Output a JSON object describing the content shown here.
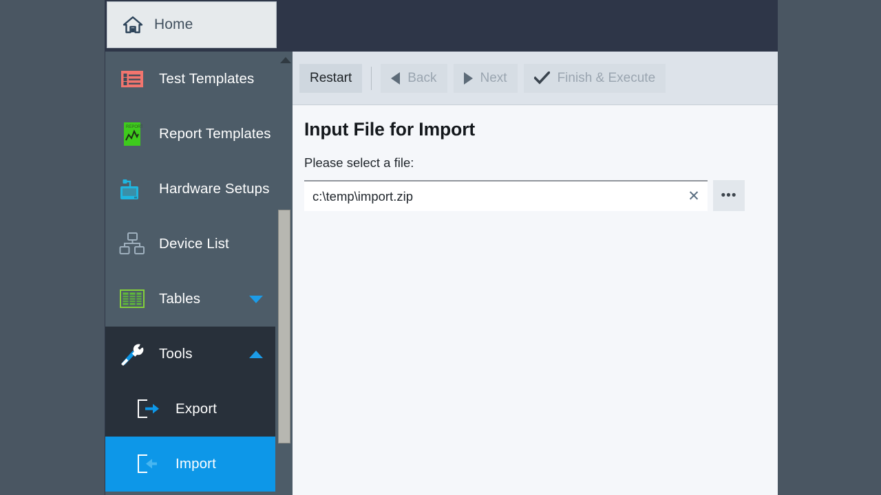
{
  "app": {
    "tab": {
      "label": "Home",
      "icon": "home-icon"
    }
  },
  "sidebar": {
    "items": [
      {
        "label": "Test Templates",
        "icon": "list-icon",
        "state": "normal",
        "chevron": ""
      },
      {
        "label": "Report Templates",
        "icon": "report-icon",
        "state": "normal",
        "chevron": ""
      },
      {
        "label": "Hardware Setups",
        "icon": "monitor-icon",
        "state": "normal",
        "chevron": ""
      },
      {
        "label": "Device List",
        "icon": "devices-icon",
        "state": "normal",
        "chevron": ""
      },
      {
        "label": "Tables",
        "icon": "table-icon",
        "state": "normal",
        "chevron": "chevron-down-icon"
      },
      {
        "label": "Tools",
        "icon": "tools-icon",
        "state": "expanded",
        "chevron": "chevron-up-icon"
      },
      {
        "label": "Export",
        "icon": "export-icon",
        "state": "sub",
        "chevron": ""
      },
      {
        "label": "Import",
        "icon": "import-icon",
        "state": "selected",
        "chevron": ""
      }
    ],
    "scroll": {
      "up_arrow": "scroll-up-arrow"
    }
  },
  "toolbar": {
    "restart_label": "Restart",
    "back_label": "Back",
    "next_label": "Next",
    "finish_label": "Finish & Execute",
    "back_icon": "triangle-left-icon",
    "next_icon": "triangle-right-icon",
    "finish_icon": "checkmark-icon"
  },
  "main": {
    "title": "Input File for Import",
    "field_label": "Please select a file:",
    "file_value": "c:\\temp\\import.zip",
    "file_placeholder": "",
    "clear_icon": "✕",
    "browse_label": "•••"
  },
  "colors": {
    "accent_blue": "#0d97e8",
    "chevron_blue": "#1c9ce8",
    "sidebar_bg": "#4d5c68",
    "sidebar_expanded_bg": "#28303a",
    "header_bg": "#2e3648",
    "toolbar_bg": "#dde3ea",
    "content_bg": "#f5f7fa",
    "desktop_bg": "#4a5662"
  }
}
